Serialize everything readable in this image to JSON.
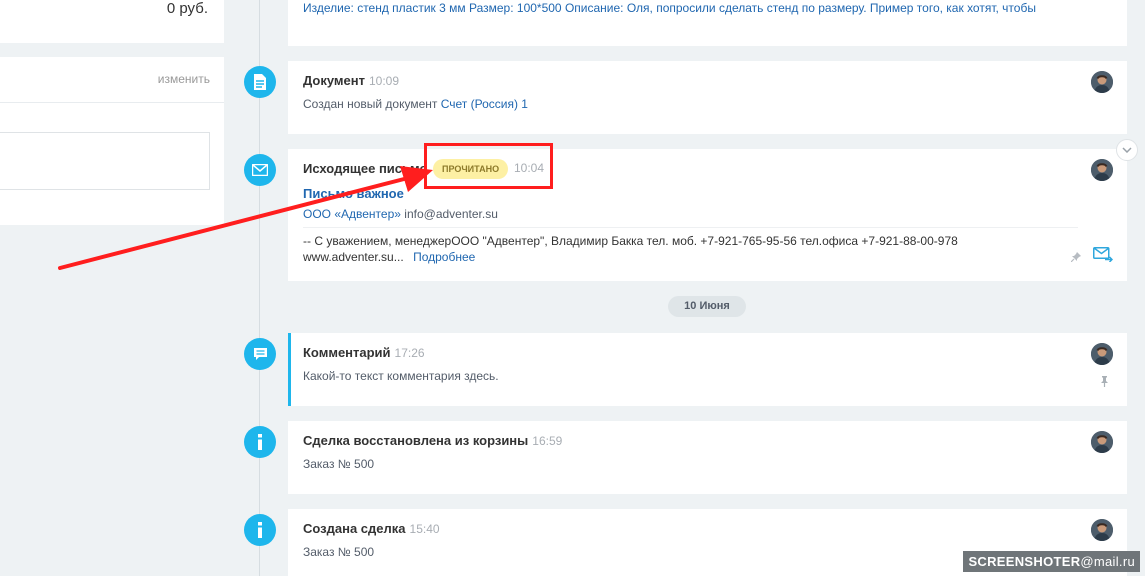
{
  "left_panel": {
    "sum": "0 руб.",
    "change_link": "изменить"
  },
  "top_card": {
    "text": "Изделие: стенд пластик 3 мм Размер: 100*500 Описание: Оля, попросили сделать стенд по размеру. Пример того, как хотят, чтобы"
  },
  "doc_card": {
    "title": "Документ",
    "time": "10:09",
    "text_prefix": "Создан новый документ",
    "link": "Счет (Россия) 1"
  },
  "mail_card": {
    "title": "Исходящее письмо",
    "badge": "ПРОЧИТАНО",
    "time": "10:04",
    "subject": "Письмо важное",
    "company": "ООО «Адвентер»",
    "email": "info@adventer.su",
    "body_line1": "-- С уважением, менеджерООО \"Адвентер\", Владимир Бакка тел. моб. +7-921-765-95-56 тел.офиса +7-921-88-00-978",
    "body_line2": "www.adventer.su...",
    "more_link": "Подробнее"
  },
  "date_separator": "10 Июня",
  "comment_card": {
    "title": "Комментарий",
    "time": "17:26",
    "text": "Какой-то текст комментария здесь."
  },
  "restore_card": {
    "title": "Сделка восстановлена из корзины",
    "time": "16:59",
    "text": "Заказ № 500"
  },
  "created_card": {
    "title": "Создана сделка",
    "time": "15:40",
    "text": "Заказ № 500"
  },
  "watermark": {
    "brand": "SCREENSHOTER",
    "domain": "@mail.ru"
  },
  "colors": {
    "accent": "#1eb6ec",
    "link": "#2067b0",
    "badge_bg": "#fdf0a4",
    "highlight": "#ff1e1e"
  }
}
